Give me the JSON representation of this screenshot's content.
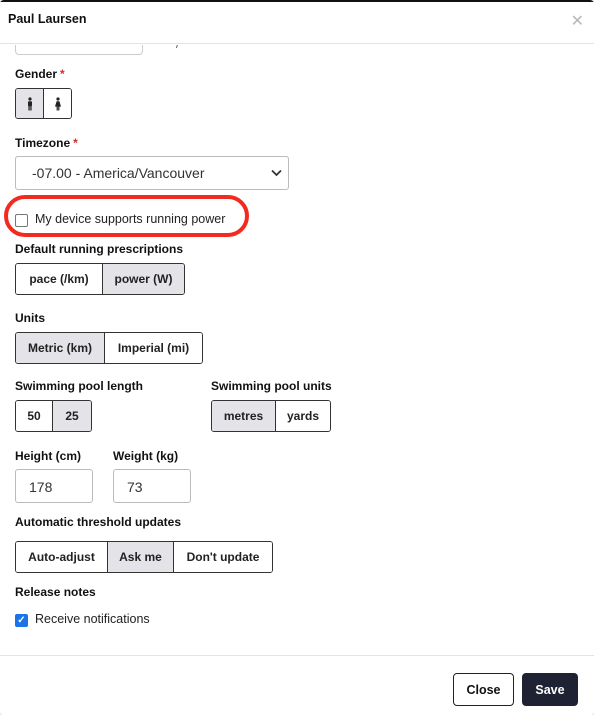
{
  "modal": {
    "title": "Paul Laursen",
    "close_icon": "close-icon"
  },
  "gender": {
    "label": "Gender",
    "required_mark": "*",
    "options": [
      {
        "icon": "male-icon",
        "active": true
      },
      {
        "icon": "female-icon",
        "active": false
      }
    ]
  },
  "timezone": {
    "label": "Timezone",
    "required_mark": "*",
    "value": "-07.00 - America/Vancouver",
    "chevron_icon": "chevron-down-icon"
  },
  "running_power": {
    "label": "My device supports running power",
    "checked": false,
    "highlight_color": "#f22b20"
  },
  "prescriptions": {
    "label": "Default running prescriptions",
    "options": [
      {
        "label": "pace (/km)",
        "active": false
      },
      {
        "label": "power (W)",
        "active": true
      }
    ]
  },
  "units": {
    "label": "Units",
    "options": [
      {
        "label": "Metric (km)",
        "active": true
      },
      {
        "label": "Imperial (mi)",
        "active": false
      }
    ]
  },
  "pool_length": {
    "label": "Swimming pool length",
    "options": [
      {
        "label": "50",
        "active": false
      },
      {
        "label": "25",
        "active": true
      }
    ]
  },
  "pool_units": {
    "label": "Swimming pool units",
    "options": [
      {
        "label": "metres",
        "active": true
      },
      {
        "label": "yards",
        "active": false
      }
    ]
  },
  "height": {
    "label": "Height (cm)",
    "value": "178"
  },
  "weight": {
    "label": "Weight (kg)",
    "value": "73"
  },
  "threshold": {
    "label": "Automatic threshold updates",
    "options": [
      {
        "label": "Auto-adjust",
        "active": false
      },
      {
        "label": "Ask me",
        "active": true
      },
      {
        "label": "Don't update",
        "active": false
      }
    ]
  },
  "release_notes": {
    "label": "Release notes",
    "notifications_label": "Receive notifications",
    "checked": true
  },
  "footer": {
    "close_label": "Close",
    "save_label": "Save"
  },
  "colors": {
    "active_segment": "#e4e4e8",
    "primary": "#1f2233",
    "checkbox": "#1a73e8",
    "required": "#d32f2f"
  }
}
